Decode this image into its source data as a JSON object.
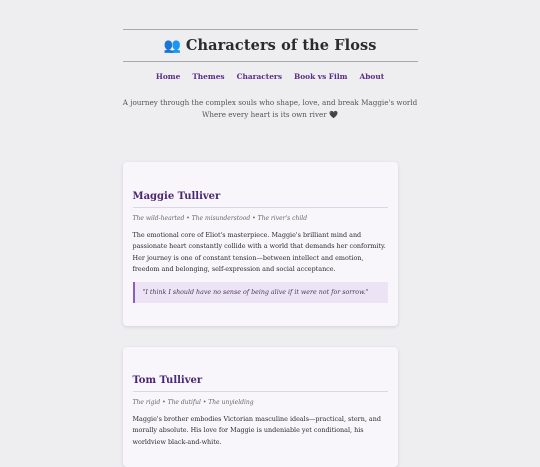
{
  "header": {
    "icon": "people-icon",
    "title": "Characters of the Floss"
  },
  "nav": {
    "items": [
      "Home",
      "Themes",
      "Characters",
      "Book vs Film",
      "About"
    ]
  },
  "intro": {
    "line1": "A journey through the complex souls who shape, love, and break Maggie's world",
    "line2": "Where every heart is its own river 🖤"
  },
  "cards": [
    {
      "name": "Maggie Tulliver",
      "traits": "The wild-hearted • The misunderstood • The river's child",
      "description": "The emotional core of Eliot's masterpiece. Maggie's brilliant mind and passionate heart constantly collide with a world that demands her conformity. Her journey is one of constant tension—between intellect and emotion, freedom and belonging, self-expression and social acceptance.",
      "quote": "\"I think I should have no sense of being alive if it were not for sorrow.\""
    },
    {
      "name": "Tom Tulliver",
      "traits": "The rigid • The dutiful • The unyielding",
      "description": "Maggie's brother embodies Victorian masculine ideals—practical, stern, and morally absolute. His love for Maggie is undeniable yet conditional, his worldview black-and-white."
    }
  ]
}
